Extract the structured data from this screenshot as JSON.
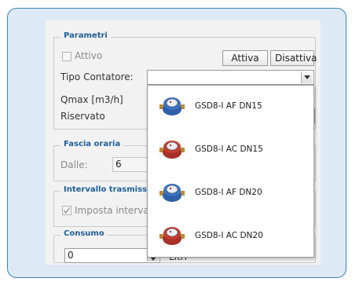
{
  "parametri": {
    "legend": "Parametri",
    "attivo_label": "Attivo",
    "attiva_button": "Attiva",
    "disattiva_button": "Disattiva",
    "tipo_contatore_label": "Tipo Contatore:",
    "tipo_contatore_value": "",
    "qmax_label": "Qmax [m3/h]",
    "riservato_label": "Riservato"
  },
  "fascia_oraria": {
    "legend": "Fascia oraria",
    "dalle_label": "Dalle:",
    "dalle_value": "6"
  },
  "intervallo": {
    "legend": "Intervallo trasmissi",
    "imposta_label": "Imposta interval",
    "imposta_checked": true
  },
  "consumo": {
    "legend": "Consumo",
    "value": "0",
    "unit_label": "Litri"
  },
  "dropdown": {
    "options": [
      {
        "label": "GSD8-I AF DN15",
        "icon": "blue-water-meter-icon",
        "color": "#2e5fa8"
      },
      {
        "label": "GSD8-I AC DN15",
        "icon": "red-water-meter-icon",
        "color": "#b83a2e"
      },
      {
        "label": "GSD8-I AF DN20",
        "icon": "blue-water-meter-icon",
        "color": "#2e5fa8"
      },
      {
        "label": "GSD8-I AC DN20",
        "icon": "red-water-meter-icon",
        "color": "#b83a2e"
      }
    ]
  },
  "colors": {
    "frame_border": "#3d82b8",
    "frame_background": "#dde9f5",
    "legend_text": "#1f5e9a"
  }
}
